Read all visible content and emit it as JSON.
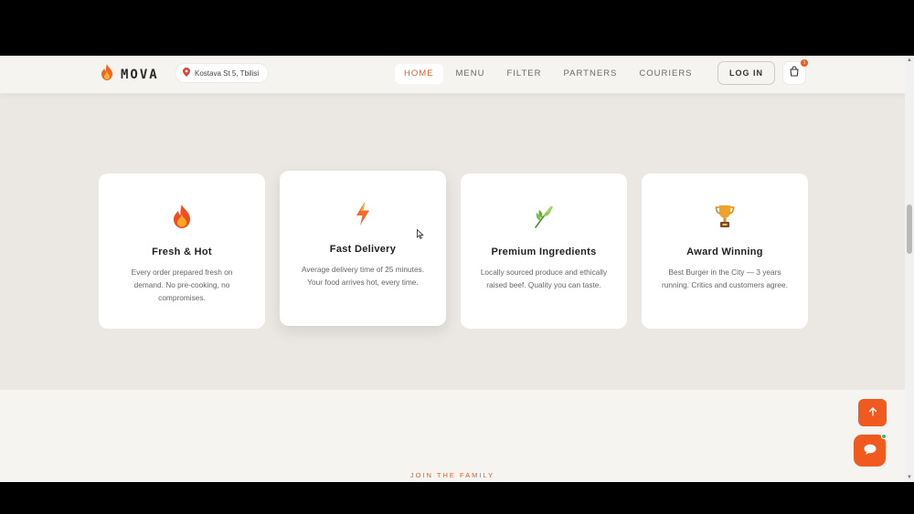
{
  "brand": {
    "name": "MOVA",
    "icon": "flame-icon"
  },
  "location": {
    "text": "Kostava St 5, Tbilisi",
    "icon": "map-pin-icon"
  },
  "nav": {
    "items": [
      {
        "label": "HOME",
        "active": true
      },
      {
        "label": "MENU",
        "active": false
      },
      {
        "label": "FILTER",
        "active": false
      },
      {
        "label": "PARTNERS",
        "active": false
      },
      {
        "label": "COURIERS",
        "active": false
      }
    ],
    "login_label": "LOG IN",
    "cart_icon": "shopping-bag-icon",
    "cart_count": "1"
  },
  "features": [
    {
      "icon": "flame-icon",
      "title": "Fresh & Hot",
      "desc": "Every order prepared fresh on demand. No pre-cooking, no compromises."
    },
    {
      "icon": "lightning-icon",
      "title": "Fast Delivery",
      "desc": "Average delivery time of 25 minutes. Your food arrives hot, every time."
    },
    {
      "icon": "leaf-icon",
      "title": "Premium Ingredients",
      "desc": "Locally sourced produce and ethically raised beef. Quality you can taste."
    },
    {
      "icon": "trophy-icon",
      "title": "Award Winning",
      "desc": "Best Burger in the City — 3 years running. Critics and customers agree."
    }
  ],
  "section_kicker": "JOIN THE FAMILY",
  "colors": {
    "accent": "#e85d24",
    "online": "#2ec25f",
    "page_bg": "#ebe8e3",
    "card_bg": "#ffffff"
  },
  "fab": {
    "up_icon": "arrow-up-icon",
    "chat_icon": "chat-bubble-icon"
  }
}
